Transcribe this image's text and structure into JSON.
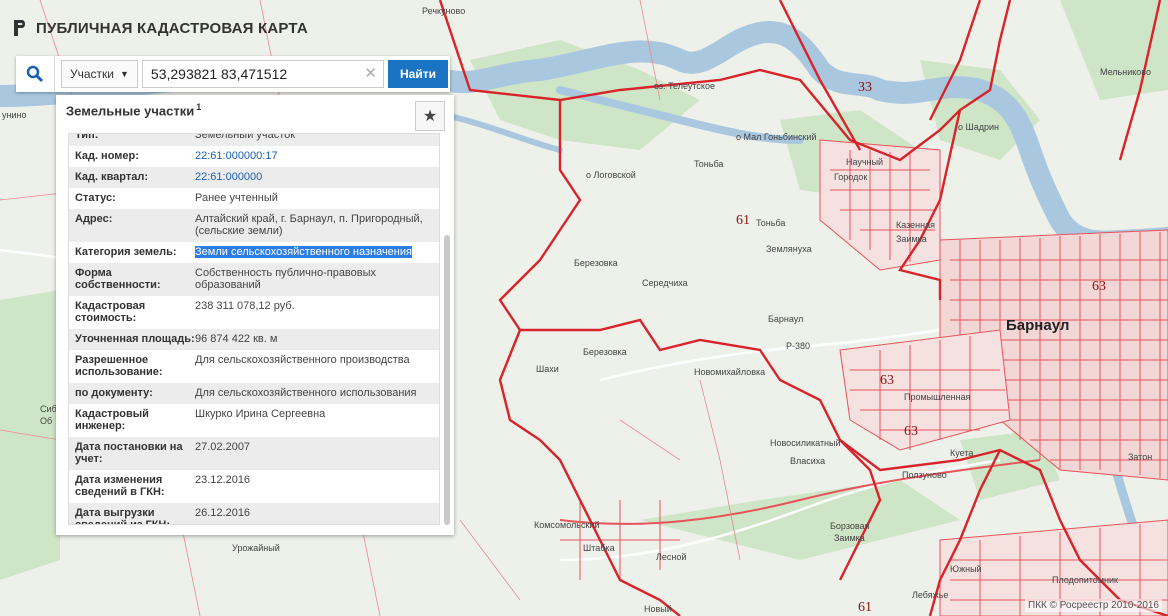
{
  "app": {
    "title": "ПУБЛИЧНАЯ КАДАСТРОВАЯ КАРТА"
  },
  "search": {
    "type_label": "Участки",
    "query": "53,293821 83,471512",
    "find_label": "Найти"
  },
  "panel": {
    "title": "Земельные участки",
    "count": "1",
    "rows": [
      {
        "key": "Тип:",
        "value": "Земельный участок"
      },
      {
        "key": "Кад. номер:",
        "value": "22:61:000000:17"
      },
      {
        "key": "Кад. квартал:",
        "value": "22:61:000000"
      },
      {
        "key": "Статус:",
        "value": "Ранее учтенный"
      },
      {
        "key": "Адрес:",
        "value": "Алтайский край, г. Барнаул, п. Пригородный, (сельские земли)"
      },
      {
        "key": "Категория земель:",
        "value": "Земли сельскохозяйственного назначения"
      },
      {
        "key": "Форма собственности:",
        "value": "Собственность публично-правовых образований"
      },
      {
        "key": "Кадастровая стоимость:",
        "value": "238 311 078,12 руб."
      },
      {
        "key": "Уточненная площадь:",
        "value": "96 874 422 кв. м"
      },
      {
        "key": "Разрешенное использование:",
        "value": "Для сельскохозяйственного производства"
      },
      {
        "key": "по документу:",
        "value": "Для сельскохозяйственного использования"
      },
      {
        "key": "Кадастровый инженер:",
        "value": "Шкурко Ирина Сергеевна"
      },
      {
        "key": "Дата постановки на учет:",
        "value": "27.02.2007"
      },
      {
        "key": "Дата изменения сведений в ГКН:",
        "value": "23.12.2016"
      },
      {
        "key": "Дата выгрузки сведений из ГКН:",
        "value": "26.12.2016"
      }
    ]
  },
  "map": {
    "labels": {
      "rechkunovo": "Речкуново",
      "teleutskoe": "оз. Телеутское",
      "logovskoy": "о Логовской",
      "mal_gonbinsky": "о Мал Гоньбинский",
      "tonba": "Тоньба",
      "tonba2": "Тоньба",
      "nauchny": "Научный",
      "gorodok": "Городок",
      "shadrin": "о Шадрин",
      "melnikovo": "Мельниково",
      "kazennaya": "Казенная",
      "zaimka": "Заимка",
      "zemlyanukha": "Землянуха",
      "berezovka": "Березовка",
      "berezovka2": "Березовка",
      "seredchikha": "Середчиха",
      "barnaul_small": "Барнаул",
      "barnaul": "Барнаул",
      "shakhi": "Шахи",
      "novomikhailovka": "Новомихайловка",
      "promyshlennaya": "Промышленная",
      "novosilikatny": "Новосиликатный",
      "vlasikha": "Власиха",
      "kuyeta": "Куета",
      "polzunovo": "Ползуново",
      "komsomolsky": "Комсомольский",
      "shtabka": "Штабка",
      "lesnoy": "Лесной",
      "borzovaya": "Борзовая",
      "zaimka2": "Заимка",
      "yuzhny": "Южный",
      "plodopitomnik": "Плодопитомник",
      "urozhainy": "Урожайный",
      "lebyazhye": "Лебяжье",
      "novy": "Новый",
      "zaton": "Затон",
      "r380": "Р-380",
      "sibir": "Сиб",
      "ob": "Об",
      "unino": "унино",
      "n33": "33",
      "n61a": "61",
      "n63a": "63",
      "n63b": "63",
      "n63c": "63",
      "n61b": "61"
    },
    "attribution": "ПКК © Росреестр 2010-2016",
    "colors": {
      "boundary": "#d8232a",
      "river": "#a9c7df",
      "forest": "#cfe5c7",
      "land": "#eef0ea"
    }
  }
}
